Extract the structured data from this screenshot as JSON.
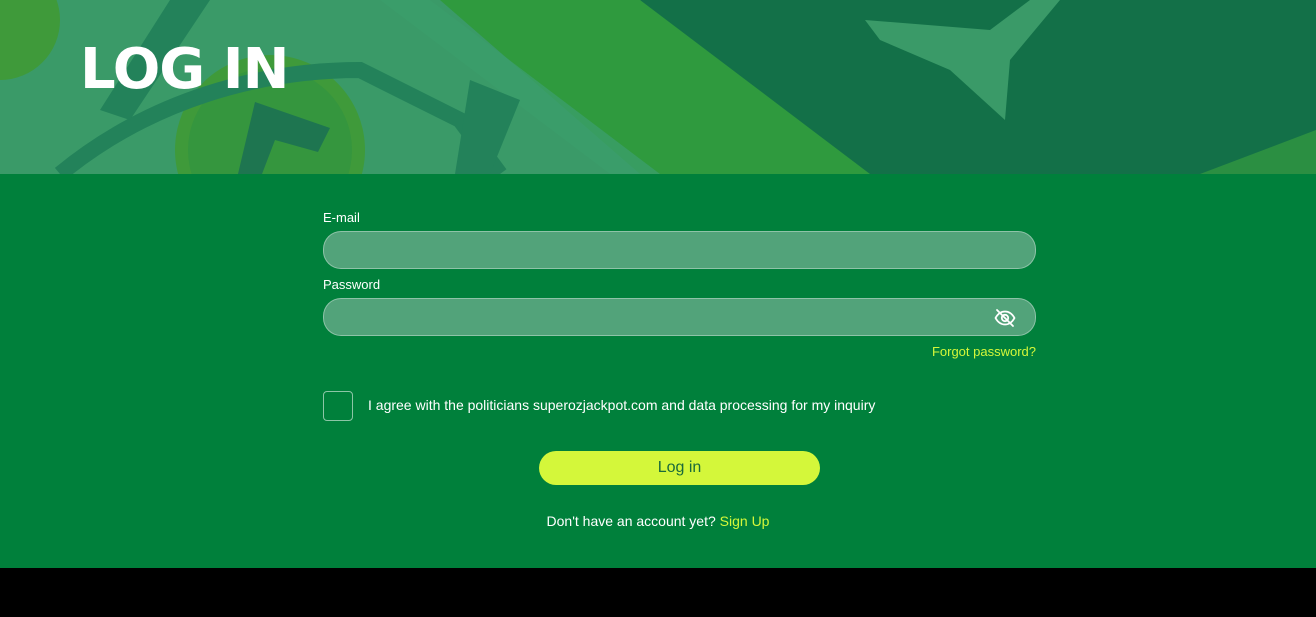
{
  "banner": {
    "title": "LOG IN"
  },
  "form": {
    "email_label": "E-mail",
    "email_value": "",
    "password_label": "Password",
    "password_value": "",
    "forgot_label": "Forgot password?",
    "agree_text": "I agree with the politicians superozjackpot.com and data processing for my inquiry",
    "agree_checked": false,
    "login_label": "Log in",
    "no_account_text": "Don't have an account yet?",
    "signup_label": "Sign Up"
  },
  "icons": {
    "password_toggle": "eye-slash-icon"
  },
  "colors": {
    "main_background": "#00803b",
    "banner_background": "#3a9a68",
    "field_background": "#52a37a",
    "accent": "#d4f73a",
    "button_text": "#1a6a3a"
  }
}
